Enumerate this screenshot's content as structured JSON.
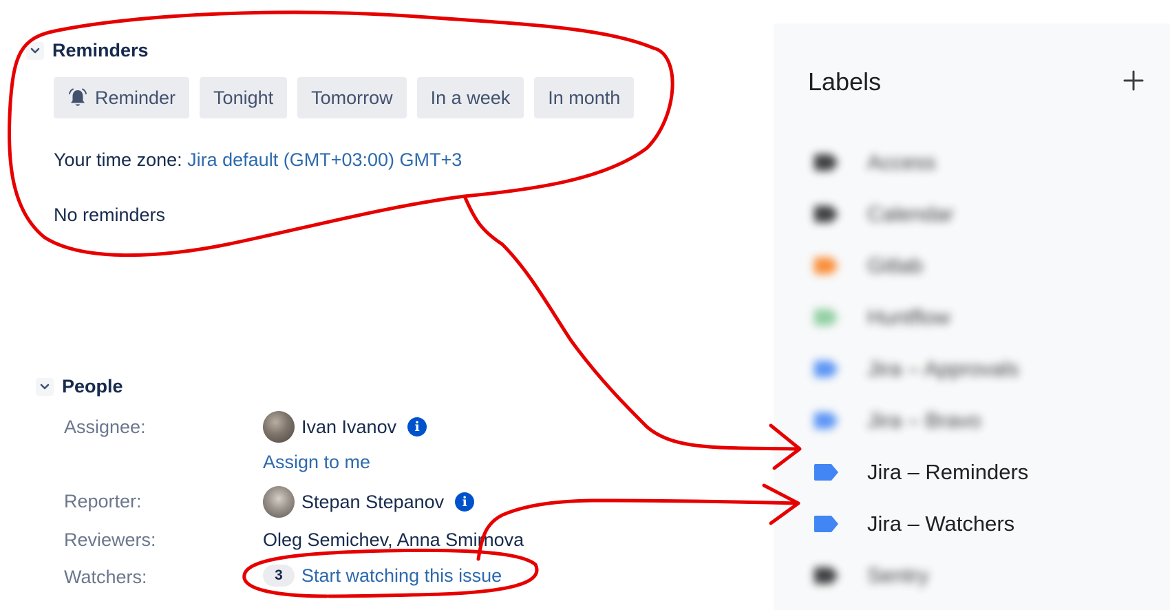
{
  "reminders": {
    "title": "Reminders",
    "buttons": [
      {
        "label": "Reminder"
      },
      {
        "label": "Tonight"
      },
      {
        "label": "Tomorrow"
      },
      {
        "label": "In a week"
      },
      {
        "label": "In month"
      }
    ],
    "timezone_label": "Your time zone: ",
    "timezone_value": "Jira default (GMT+03:00) GMT+3",
    "empty_text": "No reminders"
  },
  "people": {
    "title": "People",
    "assignee_label": "Assignee:",
    "assignee_name": "Ivan Ivanov",
    "assign_to_me": "Assign to me",
    "reporter_label": "Reporter:",
    "reporter_name": "Stepan Stepanov",
    "reviewers_label": "Reviewers:",
    "reviewers_value": "Oleg Semichev, Anna Smirnova",
    "watchers_label": "Watchers:",
    "watchers_count": "3",
    "watch_link": "Start watching this issue"
  },
  "labels": {
    "title": "Labels",
    "items": [
      {
        "label": "Access",
        "color": "#202124",
        "blurred": true
      },
      {
        "label": "Calendar",
        "color": "#202124",
        "blurred": true
      },
      {
        "label": "Gitlab",
        "color": "#fa7b17",
        "blurred": true
      },
      {
        "label": "Huntflow",
        "color": "#81c995",
        "blurred": true
      },
      {
        "label": "Jira – Approvals",
        "color": "#4285f4",
        "blurred": true
      },
      {
        "label": "Jira – Bravo",
        "color": "#4285f4",
        "blurred": true
      },
      {
        "label": "Jira – Reminders",
        "color": "#4285f4",
        "blurred": false
      },
      {
        "label": "Jira – Watchers",
        "color": "#4285f4",
        "blurred": false
      },
      {
        "label": "Sentry",
        "color": "#202124",
        "blurred": true
      }
    ]
  },
  "colors": {
    "annotation": "#e60000",
    "link": "#2d6aad",
    "info_icon": "#0052cc"
  }
}
